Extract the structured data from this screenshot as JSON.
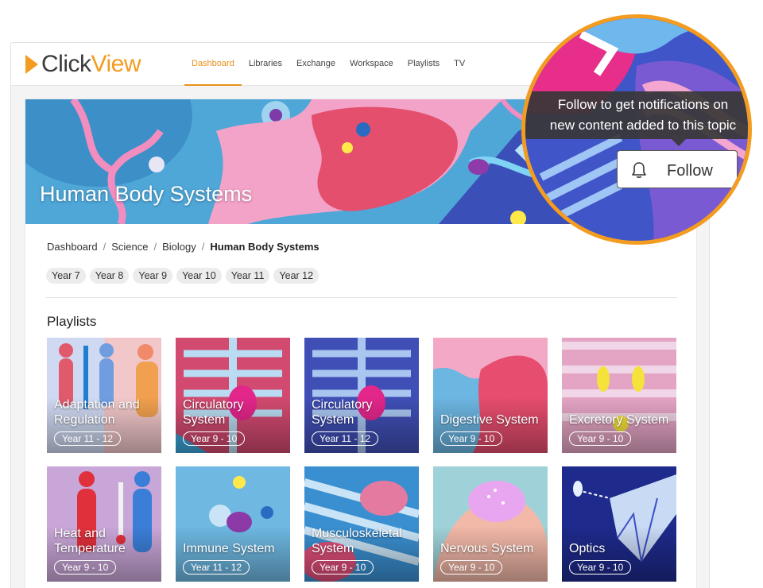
{
  "app": {
    "logo_text_a": "Click",
    "logo_text_b": "View",
    "logo_icon": "play-triangle-icon",
    "accent_color": "#f39c1f"
  },
  "nav": {
    "items": [
      {
        "label": "Dashboard",
        "active": true
      },
      {
        "label": "Libraries"
      },
      {
        "label": "Exchange"
      },
      {
        "label": "Workspace"
      },
      {
        "label": "Playlists"
      },
      {
        "label": "TV"
      }
    ]
  },
  "banner": {
    "title": "Human Body Systems"
  },
  "breadcrumb": {
    "items": [
      "Dashboard",
      "Science",
      "Biology"
    ],
    "current": "Human Body Systems",
    "separator": "/"
  },
  "years": [
    "Year 7",
    "Year 8",
    "Year 9",
    "Year 10",
    "Year 11",
    "Year 12"
  ],
  "playlists": {
    "heading": "Playlists",
    "items": [
      {
        "name": "Adaptation and Regulation",
        "year": "Year 11 - 12"
      },
      {
        "name": "Circulatory System",
        "year": "Year 9 - 10"
      },
      {
        "name": "Circulatory System",
        "year": "Year 11 - 12"
      },
      {
        "name": "Digestive System",
        "year": "Year 9 - 10"
      },
      {
        "name": "Excretory System",
        "year": "Year 9 - 10"
      },
      {
        "name": "Heat and Temperature",
        "year": "Year 9 - 10"
      },
      {
        "name": "Immune System",
        "year": "Year 11 - 12"
      },
      {
        "name": "Musculoskeletal System",
        "year": "Year 9 - 10"
      },
      {
        "name": "Nervous System",
        "year": "Year 9 - 10"
      },
      {
        "name": "Optics",
        "year": "Year 9 - 10"
      }
    ]
  },
  "follow": {
    "tooltip_line1": "Follow to get notifications on",
    "tooltip_line2": "new content added to this topic",
    "button_label": "Follow",
    "icon": "bell-icon"
  }
}
